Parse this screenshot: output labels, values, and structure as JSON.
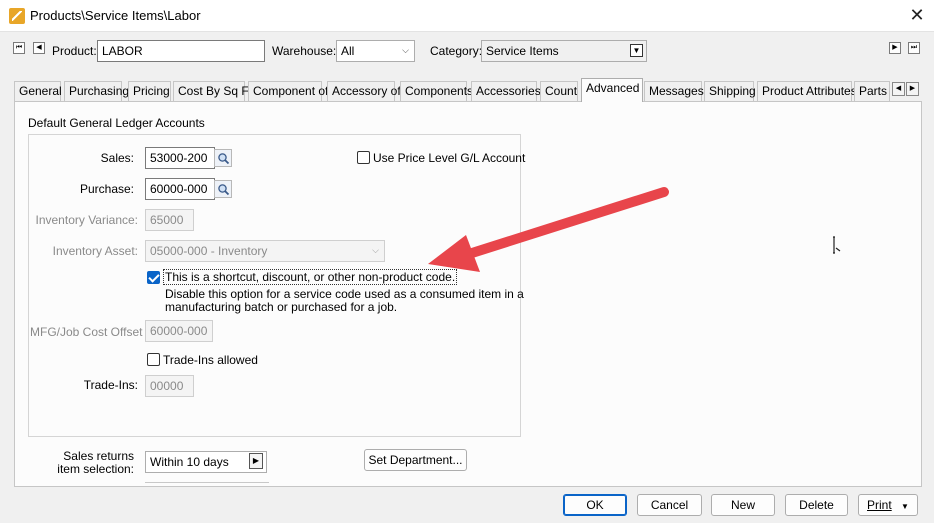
{
  "window": {
    "title": "Products\\Service Items\\Labor",
    "close_glyph": "✕"
  },
  "header": {
    "product_label": "Product:",
    "product_value": "LABOR",
    "warehouse_label": "Warehouse:",
    "warehouse_value": "All",
    "category_label": "Category:",
    "category_value": "Service Items"
  },
  "tabs": [
    {
      "label": "General"
    },
    {
      "label": "Purchasing"
    },
    {
      "label": "Pricing"
    },
    {
      "label": "Cost By Sq Ft"
    },
    {
      "label": "Component of"
    },
    {
      "label": "Accessory of"
    },
    {
      "label": "Components"
    },
    {
      "label": "Accessories"
    },
    {
      "label": "Count"
    },
    {
      "label": "Advanced",
      "active": true
    },
    {
      "label": "Messages"
    },
    {
      "label": "Shipping"
    },
    {
      "label": "Product Attributes"
    },
    {
      "label": "Parts C"
    }
  ],
  "gl": {
    "section_title": "Default General Ledger Accounts",
    "sales_label": "Sales:",
    "sales_value": "53000-200",
    "purchase_label": "Purchase:",
    "purchase_value": "60000-000",
    "use_price_level_label": "Use Price Level G/L Account",
    "use_price_level_checked": false,
    "inv_variance_label": "Inventory Variance:",
    "inv_variance_value": "65000",
    "inv_asset_label": "Inventory Asset:",
    "inv_asset_value": "05000-000 - Inventory",
    "shortcut_label": "This is a shortcut, discount, or other non-product code.",
    "shortcut_checked": true,
    "shortcut_help_1": "Disable this option for a service code used as a consumed item in a",
    "shortcut_help_2": "manufacturing batch or purchased for a job.",
    "mfg_label": "MFG/Job Cost Offset",
    "mfg_value": "60000-000",
    "tradeins_allowed_label": "Trade-Ins allowed",
    "tradeins_allowed_checked": false,
    "tradeins_label": "Trade-Ins:",
    "tradeins_value": "00000"
  },
  "returns": {
    "label_line1": "Sales returns",
    "label_line2": "item selection:",
    "value": "Within 10  days",
    "set_department": "Set Department..."
  },
  "footer": {
    "ok": "OK",
    "cancel": "Cancel",
    "new": "New",
    "delete": "Delete",
    "print": "Print"
  },
  "colors": {
    "arrow": "#e8454b",
    "accent": "#0a64c8"
  }
}
